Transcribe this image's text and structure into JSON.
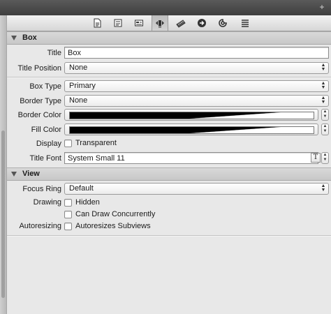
{
  "toolbar": {
    "tabs": [
      {
        "icon": "file-icon"
      },
      {
        "icon": "identity-icon"
      },
      {
        "icon": "attributes-icon"
      },
      {
        "icon": "size-icon"
      },
      {
        "icon": "ruler-icon"
      },
      {
        "icon": "connections-icon"
      },
      {
        "icon": "bindings-icon"
      },
      {
        "icon": "effects-icon"
      }
    ],
    "active_index": 3,
    "add_glyph": "+"
  },
  "box_section": {
    "header": "Box",
    "title_label": "Title",
    "title_value": "Box",
    "title_position_label": "Title Position",
    "title_position_value": "None",
    "box_type_label": "Box Type",
    "box_type_value": "Primary",
    "border_type_label": "Border Type",
    "border_type_value": "None",
    "border_color_label": "Border Color",
    "border_color": "#000000",
    "fill_color_label": "Fill Color",
    "fill_color": "#000000",
    "display_label": "Display",
    "transparent_label": "Transparent",
    "transparent_checked": false,
    "title_font_label": "Title Font",
    "title_font_value": "System Small 11",
    "font_button_glyph": "T"
  },
  "view_section": {
    "header": "View",
    "focus_ring_label": "Focus Ring",
    "focus_ring_value": "Default",
    "drawing_label": "Drawing",
    "hidden_label": "Hidden",
    "hidden_checked": false,
    "concurrent_label": "Can Draw Concurrently",
    "concurrent_checked": false,
    "autoresizing_label": "Autoresizing",
    "autoresizes_label": "Autoresizes Subviews",
    "autoresizes_checked": false
  }
}
